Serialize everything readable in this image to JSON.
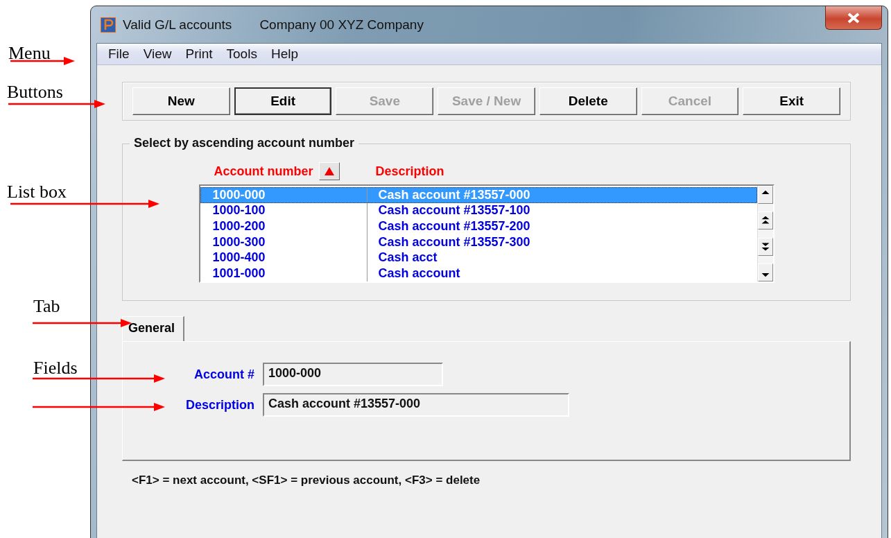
{
  "annotations": [
    {
      "kind": "labeled",
      "label": "Menu"
    },
    {
      "kind": "labeled",
      "label": "Buttons"
    },
    {
      "kind": "labeled",
      "label": "List box"
    },
    {
      "kind": "labeled",
      "label": "Tab"
    },
    {
      "kind": "labeled",
      "label": "Fields"
    },
    {
      "kind": "arrow"
    }
  ],
  "window": {
    "title": "Valid G/L accounts",
    "company": "Company 00  XYZ Company"
  },
  "menu": [
    {
      "label": "File"
    },
    {
      "label": "View"
    },
    {
      "label": "Print"
    },
    {
      "label": "Tools"
    },
    {
      "label": "Help"
    }
  ],
  "buttons": [
    {
      "label": "New",
      "disabled": false,
      "default": false
    },
    {
      "label": "Edit",
      "disabled": false,
      "default": true
    },
    {
      "label": "Save",
      "disabled": true,
      "default": false
    },
    {
      "label": "Save / New",
      "disabled": true,
      "default": false
    },
    {
      "label": "Delete",
      "disabled": false,
      "default": false
    },
    {
      "label": "Cancel",
      "disabled": true,
      "default": false
    },
    {
      "label": "Exit",
      "disabled": false,
      "default": false
    }
  ],
  "list": {
    "title": "Select by ascending account number",
    "columns": [
      {
        "label": "Account number",
        "sorted": true
      },
      {
        "label": "Description",
        "sorted": false
      }
    ],
    "rows": [
      {
        "account": "1000-000",
        "description": "Cash account #13557-000",
        "selected": true
      },
      {
        "account": "1000-100",
        "description": "Cash account #13557-100",
        "selected": false
      },
      {
        "account": "1000-200",
        "description": "Cash account #13557-200",
        "selected": false
      },
      {
        "account": "1000-300",
        "description": "Cash account #13557-300",
        "selected": false
      },
      {
        "account": "1000-400",
        "description": "Cash acct",
        "selected": false
      },
      {
        "account": "1001-000",
        "description": "Cash account",
        "selected": false
      }
    ]
  },
  "tabs": [
    {
      "label": "General",
      "selected": true
    }
  ],
  "fields": [
    {
      "label": "Account #",
      "value": "1000-000"
    },
    {
      "label": "Description",
      "value": "Cash account #13557-000"
    }
  ],
  "status_text": "<F1> = next account, <SF1> = previous account, <F3> = delete"
}
